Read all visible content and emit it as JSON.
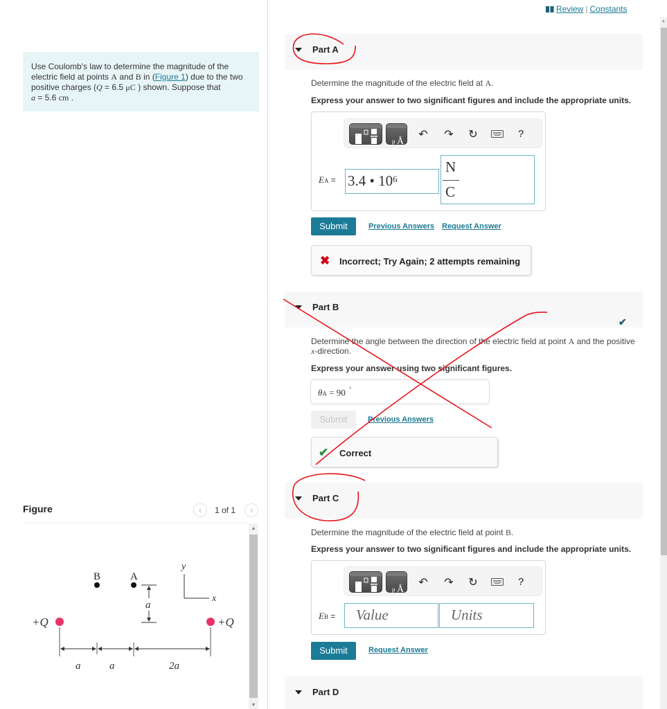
{
  "intro": {
    "line1": "Use Coulomb's law to determine the magnitude of the",
    "line2_pre": "electric field at points ",
    "point_a": "A",
    "and": " and ",
    "point_b": "B",
    "in": " in (",
    "figure_link": "Figure 1",
    "line2_post": ") due to the two",
    "line3_pre": "positive charges (",
    "q_sym": "Q",
    "q_eq": " = 6.5 ",
    "q_unit": "μC",
    "line3_post": " ) shown. Suppose that",
    "a_sym": "a",
    "a_eq": " = 5.6 ",
    "a_unit": "cm",
    "a_end": " ."
  },
  "figure": {
    "header": "Figure",
    "pager": "1 of 1",
    "prev_icon": "chevron-left-icon",
    "next_icon": "chevron-right-icon",
    "labels": {
      "B": "B",
      "A": "A",
      "y": "y",
      "x": "x",
      "a_vert": "a",
      "left_charge": "+Q",
      "right_charge": "+Q",
      "dim1": "a",
      "dim2": "a",
      "dim3": "2a"
    },
    "colors": {
      "charge": "#e8336a",
      "point": "#111111"
    }
  },
  "top_links": {
    "review": "Review",
    "separator": "|",
    "constants": "Constants"
  },
  "parts": [
    {
      "title": "Part A",
      "prompt_pre": "Determine the magnitude of the electric field at ",
      "prompt_var": "A",
      "prompt_post": ".",
      "instruction": "Express your answer to two significant figures and include the appropriate units.",
      "label_sym": "E",
      "label_sub": "A",
      "label_eq": " =",
      "value_mantissa": "3.4 • 10",
      "value_exp": "6",
      "units_num": "N",
      "units_den": "C",
      "submit": "Submit",
      "link1": "Previous Answers",
      "link2": "Request Answer",
      "feedback": "Incorrect; Try Again; 2 attempts remaining",
      "feedback_icon": "x-icon"
    },
    {
      "title": "Part B",
      "prompt_pre": "Determine the angle between the direction of the electric field at point ",
      "prompt_var": "A",
      "prompt_post": " and the positive",
      "prompt_line2_var": "x",
      "prompt_line2": "-direction.",
      "instruction": "Express your answer using two significant figures.",
      "label_sym": "θ",
      "label_sub": "A",
      "label_eq": " = ",
      "value": "90",
      "unit": "°",
      "submit": "Submit",
      "link1": "Previous Answers",
      "feedback": "Correct",
      "status": "completed"
    },
    {
      "title": "Part C",
      "prompt_pre": "Determine the magnitude of the electric field at point ",
      "prompt_var": "B",
      "prompt_post": ".",
      "instruction": "Express your answer to two significant figures and include the appropriate units.",
      "label_sym": "E",
      "label_sub": "B",
      "label_eq": " =",
      "value_placeholder": "Value",
      "units_placeholder": "Units",
      "submit": "Submit",
      "link2": "Request Answer"
    },
    {
      "title": "Part D"
    }
  ],
  "toolbar": {
    "undo_icon": "undo-icon",
    "redo_icon": "redo-icon",
    "reset_icon": "reset-icon",
    "keyboard_icon": "keyboard-icon",
    "help": "?"
  },
  "colors": {
    "accent": "#1c7b96",
    "link": "#1a7a94",
    "intro_bg": "#e8f5f7",
    "incorrect": "#d0021b",
    "correct_check": "#2e8b3e",
    "status_check": "#1c5f73",
    "annotation_red": "#e8141b"
  }
}
